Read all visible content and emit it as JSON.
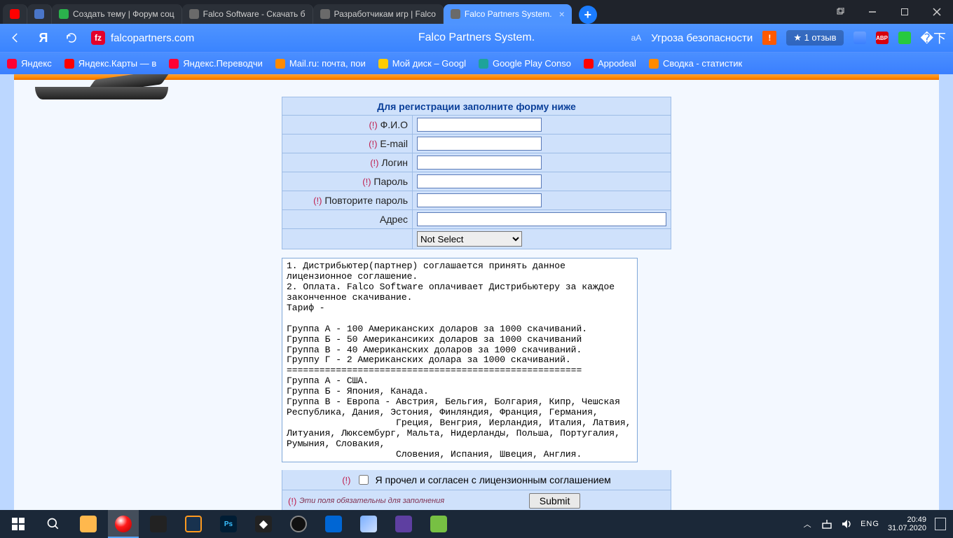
{
  "browser": {
    "tabs": [
      {
        "label": "",
        "color": "c-red"
      },
      {
        "label": "",
        "color": "c-blue"
      },
      {
        "label": "Создать тему | Форум соц",
        "color": "c-green"
      },
      {
        "label": "Falco Software - Скачать б",
        "color": "c-grey"
      },
      {
        "label": "Разработчикам игр | Falco",
        "color": "c-grey"
      },
      {
        "label": "Falco Partners System.",
        "color": "c-grey",
        "active": true
      }
    ],
    "newtab": "+",
    "url": "falcopartners.com",
    "title_center": "Falco Partners System.",
    "security_text": "Угроза безопасности",
    "review_pill": "★ 1 отзыв",
    "bookmarks": [
      {
        "label": "Яндекс",
        "color": "c-yred"
      },
      {
        "label": "Яндекс.Карты — в",
        "color": "c-red"
      },
      {
        "label": "Яндекс.Переводчи",
        "color": "c-yred"
      },
      {
        "label": "Mail.ru: почта, пои",
        "color": "c-orange"
      },
      {
        "label": "Мой диск – Googl",
        "color": "c-yellow"
      },
      {
        "label": "Google Play Conso",
        "color": "c-teal"
      },
      {
        "label": "Appodeal",
        "color": "c-red"
      },
      {
        "label": "Сводка - статистик",
        "color": "c-orange"
      }
    ]
  },
  "form": {
    "header": "Для регистрации заполните форму ниже",
    "req_mark": "(!)",
    "labels": {
      "fio": "Ф.И.О",
      "email": "E-mail",
      "login": "Логин",
      "password": "Пароль",
      "password2": "Повторите пароль",
      "address": "Адрес"
    },
    "select_default": "Not Select",
    "license_text": "1. Дистрибьютер(партнер) соглашается принять данное лицензионное соглашение.\n2. Оплата. Falco Software оплачивает Дистрибьютеру за каждое законченное скачивание.\nТариф -\n\nГруппа А - 100 Американских доларов за 1000 скачиваний.\nГруппа Б - 50 Американсиких доларов за 1000 скачиваний\nГруппа В - 40 Американских доларов за 1000 скачиваний.\nГруппу Г - 2 Американских долара за 1000 скачиваний.\n======================================================\nГруппа А - США.\nГруппа Б - Япония, Канада.\nГруппа В - Европа - Австрия, Бельгия, Болгария, Кипр, Чешская Республика, Дания, Эстония, Финляндия, Франция, Германия,\n                    Греция, Венгрия, Иерландия, Италия, Латвия, Литуания, Люксембург, Мальта, Нидерланды, Польша, Португалия, Румыния, Словакия,\n                    Словения, Испания, Швеция, Англия.",
    "agree_label": "Я прочел и согласен с лицензионным соглашением",
    "footnote": "Эти поля обязательны для заполнения",
    "submit": "Submit"
  },
  "tray": {
    "lang": "ENG",
    "time": "20:49",
    "date": "31.07.2020"
  }
}
